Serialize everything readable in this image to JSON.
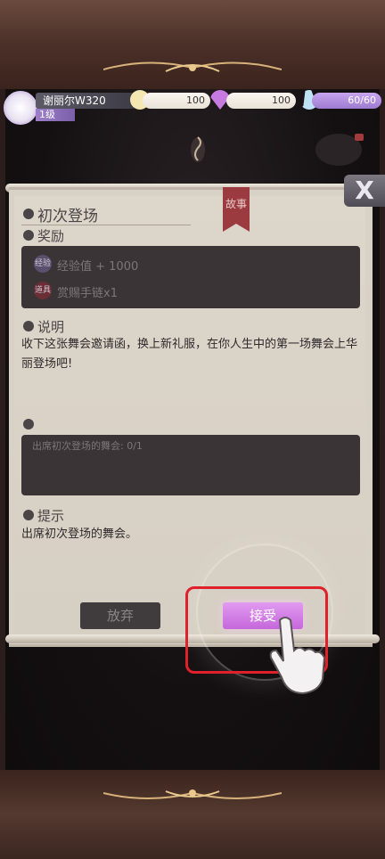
{
  "player": {
    "name": "谢丽尔W320",
    "level": "1级"
  },
  "resources": {
    "gold": "100",
    "gems": "100",
    "stamina": "60/60"
  },
  "quest": {
    "tag": "故事",
    "title": "初次登场",
    "reward_label": "奖励",
    "rewards": [
      {
        "badge": "经验",
        "text": "经验值 + 1000"
      },
      {
        "badge": "道具",
        "text": "赏赐手链x1"
      }
    ],
    "desc_label": "说明",
    "description": "收下这张舞会邀请函，换上新礼服，在你人生中的第一场舞会上华丽登场吧!",
    "progress_text": "出席初次登场的舞会: 0/1",
    "hint_label": "提示",
    "hint": "出席初次登场的舞会。"
  },
  "buttons": {
    "abandon": "放弃",
    "accept": "接受",
    "close": "X"
  },
  "colors": {
    "accept": "#d47ae6",
    "highlight": "#e0202a",
    "story_tag": "#9c3b3f"
  }
}
